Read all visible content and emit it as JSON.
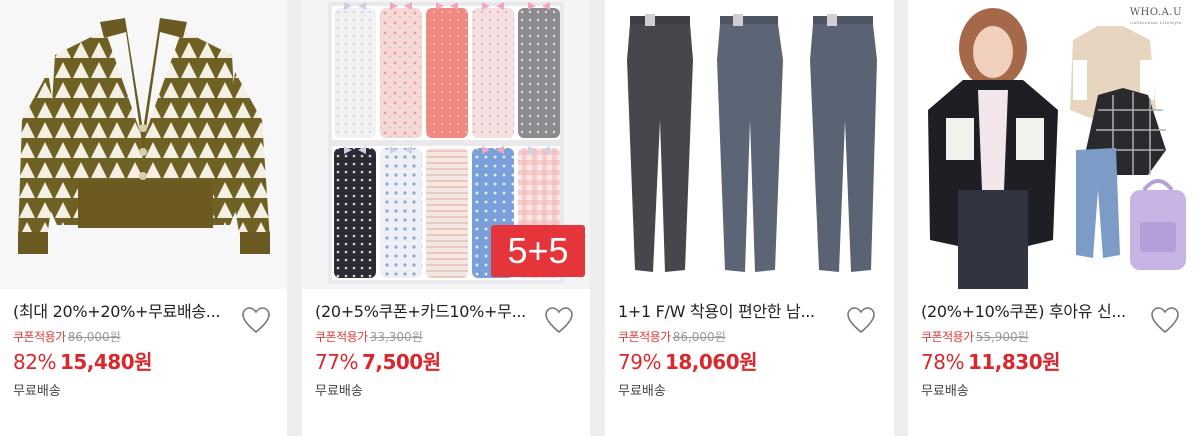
{
  "products": [
    {
      "title": "(최대 20%+20%+무료배송...",
      "coupon_label": "쿠폰적용가",
      "original_price": "86,000원",
      "discount": "82%",
      "price": "15,480원",
      "shipping": "무료배송",
      "image_icon": "cardigan-image"
    },
    {
      "title": "(20+5%쿠폰+카드10%+무...",
      "coupon_label": "쿠폰적용가",
      "original_price": "33,300원",
      "discount": "77%",
      "price": "7,500원",
      "shipping": "무료배송",
      "badge": "5+5",
      "image_icon": "underwear-set-image"
    },
    {
      "title": "1+1 F/W 착용이 편안한 남...",
      "coupon_label": "쿠폰적용가",
      "original_price": "86,000원",
      "discount": "79%",
      "price": "18,060원",
      "shipping": "무료배송",
      "image_icon": "pants-image"
    },
    {
      "title": "(20%+10%쿠폰) 후아유 신...",
      "coupon_label": "쿠폰적용가",
      "original_price": "55,900원",
      "discount": "78%",
      "price": "11,830원",
      "shipping": "무료배송",
      "brand_logo": "WHO.A.U",
      "brand_sub": "Californian Lifestyle",
      "image_icon": "fleece-jacket-image"
    }
  ],
  "colors": {
    "accent_red": "#d9272e",
    "coupon_red": "#e03b3b",
    "background": "#eeeeee"
  }
}
